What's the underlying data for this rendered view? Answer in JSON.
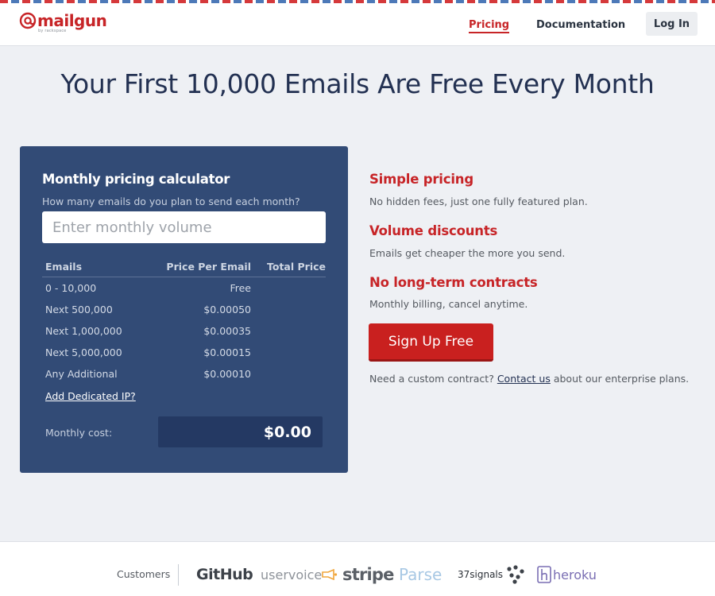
{
  "header": {
    "logo_text": "mailgun",
    "logo_sub": "by rackspace",
    "nav": {
      "pricing": "Pricing",
      "documentation": "Documentation",
      "login": "Log In"
    }
  },
  "hero": {
    "title": "Your First 10,000 Emails Are Free Every Month"
  },
  "calculator": {
    "title": "Monthly pricing calculator",
    "subtitle": "How many emails do you plan to send each month?",
    "input_placeholder": "Enter monthly volume",
    "input_value": "",
    "columns": [
      "Emails",
      "Price Per Email",
      "Total Price"
    ],
    "rows": [
      {
        "emails": "0  -  10,000",
        "price": "Free",
        "total": ""
      },
      {
        "emails": "Next 500,000",
        "price": "$0.00050",
        "total": ""
      },
      {
        "emails": "Next 1,000,000",
        "price": "$0.00035",
        "total": ""
      },
      {
        "emails": "Next 5,000,000",
        "price": "$0.00015",
        "total": ""
      },
      {
        "emails": "Any Additional",
        "price": "$0.00010",
        "total": ""
      }
    ],
    "dedicated_ip_link": "Add Dedicated IP?",
    "monthly_cost_label": "Monthly cost:",
    "monthly_cost_value": "$0.00"
  },
  "features": [
    {
      "title": "Simple pricing",
      "text": "No hidden fees, just one fully featured plan."
    },
    {
      "title": "Volume discounts",
      "text": "Emails get cheaper the more you send."
    },
    {
      "title": "No long-term contracts",
      "text": "Monthly billing, cancel anytime."
    }
  ],
  "signup_button": "Sign Up Free",
  "contract": {
    "prefix": "Need a custom contract? ",
    "link": "Contact us",
    "suffix": " about our enterprise plans."
  },
  "footer": {
    "customers_label": "Customers",
    "logos": [
      "GitHub",
      "uservoice",
      "stripe",
      "Parse",
      "37signals",
      "heroku"
    ]
  },
  "colors": {
    "brand_red": "#c72427",
    "calculator_bg": "#324b76",
    "heading_navy": "#233152"
  }
}
